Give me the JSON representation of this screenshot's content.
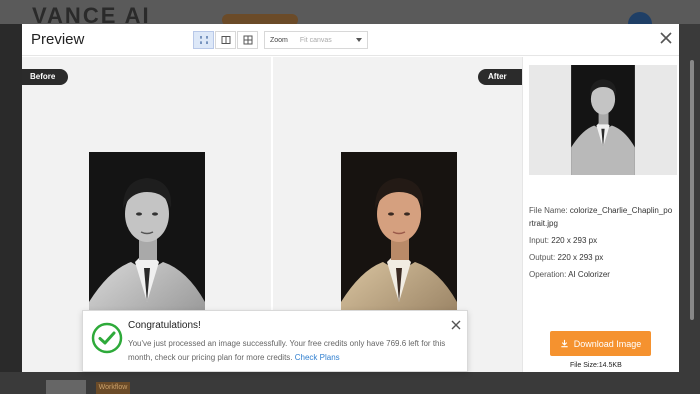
{
  "background": {
    "logo_text": "VANCE AI",
    "bottom_tag": "Workflow"
  },
  "modal": {
    "title": "Preview",
    "zoom_label": "Zoom",
    "zoom_value": "Fit canvas",
    "before_tag": "Before",
    "after_tag": "After"
  },
  "info": {
    "file_name_label": "File Name:",
    "file_name_line1": "colorize_Charlie_Chaplin_po",
    "file_name_line2": "rtrait.jpg",
    "input_label": "Input:",
    "input_value": "220 x 293 px",
    "output_label": "Output:",
    "output_value": "220 x 293 px",
    "operation_label": "Operation:",
    "operation_value": "AI Colorizer"
  },
  "download": {
    "label": "Download Image",
    "file_size": "File Size:14.5KB"
  },
  "toast": {
    "title": "Congratulations!",
    "message": "You've just processed an image successfully. Your free credits only have 769.6 left for this month, check our pricing plan for more credits.",
    "link": "Check Plans"
  },
  "colors": {
    "accent": "#f5922f",
    "success": "#2eaa3a",
    "link": "#2f7fd0"
  }
}
